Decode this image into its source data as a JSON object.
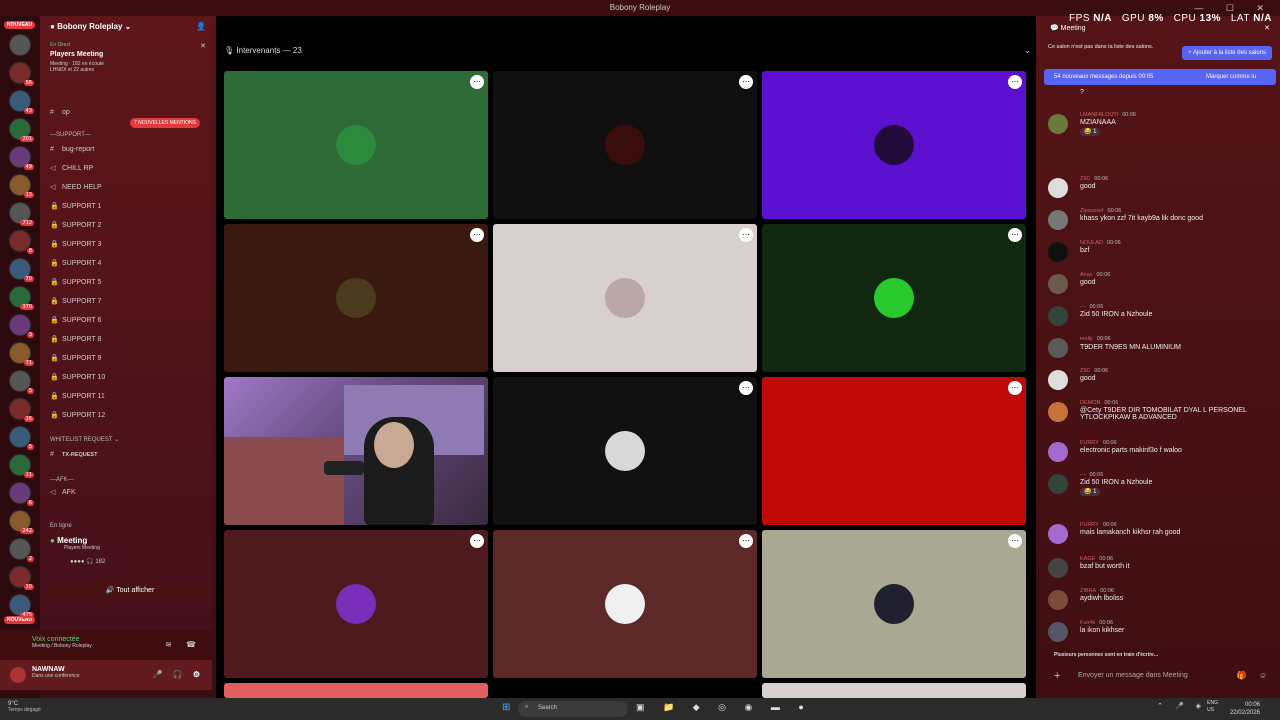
{
  "window": {
    "title": "Bobony Roleplay",
    "controls": "— ☐ ✕"
  },
  "servers": [
    {
      "badge": ""
    },
    {
      "badge": "56"
    },
    {
      "badge": "43"
    },
    {
      "badge": "201"
    },
    {
      "badge": "49"
    },
    {
      "badge": "13"
    },
    {
      "badge": "712"
    },
    {
      "badge": "8"
    },
    {
      "badge": "70"
    },
    {
      "badge": "370"
    },
    {
      "badge": "3"
    },
    {
      "badge": "71"
    },
    {
      "badge": "5"
    },
    {
      "badge": "16"
    },
    {
      "badge": "5"
    },
    {
      "badge": "11"
    },
    {
      "badge": "6"
    },
    {
      "badge": "242"
    },
    {
      "badge": "2"
    },
    {
      "badge": "10"
    },
    {
      "badge": "475"
    }
  ],
  "servers_new_label": "NOUVEAU",
  "guild": {
    "name": "Bobony Roleplay"
  },
  "event": {
    "live": "En Direct",
    "title": "Players Meeting",
    "info": "Meeting ·  182 en écoute",
    "users": "LHNIDI et 22 autres"
  },
  "mentions_pill": "7 NOUVELLES MENTIONS",
  "channel_op": "op",
  "channels": [
    {
      "icon": "#",
      "label": "bug-report"
    },
    {
      "icon": "◁",
      "label": "CHILL RP"
    },
    {
      "icon": "◁",
      "label": "NEED HELP"
    },
    {
      "icon": "🔒",
      "label": "SUPPORT 1"
    },
    {
      "icon": "🔒",
      "label": "SUPPORT 2"
    },
    {
      "icon": "🔒",
      "label": "SUPPORT 3"
    },
    {
      "icon": "🔒",
      "label": "SUPPORT 4"
    },
    {
      "icon": "🔒",
      "label": "SUPPORT 5"
    },
    {
      "icon": "🔒",
      "label": "SUPPORT 7"
    },
    {
      "icon": "🔒",
      "label": "SUPPORT 6"
    },
    {
      "icon": "🔒",
      "label": "SUPPORT 8"
    },
    {
      "icon": "🔒",
      "label": "SUPPORT 9"
    },
    {
      "icon": "🔒",
      "label": "SUPPORT 10"
    },
    {
      "icon": "🔒",
      "label": "SUPPORT 11"
    },
    {
      "icon": "🔒",
      "label": "SUPPORT 12"
    }
  ],
  "cat_support": "—SUPPORT—",
  "cat_whitelist": "WHITELIST REQUEST ⌄",
  "tx_request": "TX-REQUEST",
  "cat_afk": "—AFK—",
  "afk_channel": "AFK",
  "online_section": "En ligne",
  "meeting": {
    "name": "Meeting",
    "sub": "Players Meeting",
    "count": "182"
  },
  "show_all": "Tout afficher",
  "voice": {
    "status": "Voix connectée",
    "where": "Meeting / Bobony Roleplay"
  },
  "user": {
    "name": "NAWNAW",
    "status": "Dans une conférence"
  },
  "stage": {
    "speakers": "Intervenants — 23"
  },
  "tiles": [
    {
      "bg": "#2e6b36",
      "av": "#2c8a3c"
    },
    {
      "bg": "#0f0f0f",
      "av": "#3a0c0c"
    },
    {
      "bg": "#5b10d0",
      "av": "#220a3a"
    },
    {
      "bg": "#3a1a10",
      "av": "#4a3a1e"
    },
    {
      "bg": "#d8d0cf",
      "av": "#b9a8a7"
    },
    {
      "bg": "#102810",
      "av": "#27c92c"
    },
    {
      "bg": "webcam",
      "av": ""
    },
    {
      "bg": "#111111",
      "av": "#d8d8d8"
    },
    {
      "bg": "#c00a0a",
      "av": "#c00a0a"
    },
    {
      "bg": "#4e1a1d",
      "av": "#7a2db8"
    },
    {
      "bg": "#5c2828",
      "av": "#f0f0f0"
    },
    {
      "bg": "#a9a892",
      "av": "#202030"
    }
  ],
  "stats": {
    "fps": "FPS",
    "fps_v": "N/A",
    "gpu": "GPU",
    "gpu_v": "8%",
    "cpu": "CPU",
    "cpu_v": "13%",
    "lat": "LAT",
    "lat_v": "N/A"
  },
  "chat": {
    "title": "Meeting",
    "notice": "Ce salon n'est pas dans ta liste des salons.",
    "add_btn": "+ Ajouter à la liste des salons",
    "new_messages": "54 nouveaux messages depuis 00:05",
    "mark_read": "Marquer comme lu",
    "messages": [
      {
        "author": "",
        "time": "",
        "text": "?",
        "react": "",
        "av": "#6b2a2a"
      },
      {
        "author": "LMANFALOUTI",
        "time": "00:06",
        "text": "MZIANAAA",
        "react": "😂 1",
        "av": "#6a7a3a"
      },
      {
        "author": "Z9C",
        "time": "00:06",
        "text": "good",
        "react": "",
        "av": "#dddddd"
      },
      {
        "author": "Zlyoussef",
        "time": "00:06",
        "text": "khass ykon zzf 7it kayb9a lik donc good",
        "react": "",
        "av": "#777"
      },
      {
        "author": "NOULAD",
        "time": "00:06",
        "text": "bzf",
        "react": "",
        "av": "#111"
      },
      {
        "author": "Anas",
        "time": "00:06",
        "text": "good",
        "react": "",
        "av": "#6c5a4a"
      },
      {
        "author": "—",
        "time": "00:06",
        "text": "Zid 50 IRON a Nzhoule",
        "react": "",
        "av": "#33453a"
      },
      {
        "author": "Ⲙolly",
        "time": "00:06",
        "text": "T9DER TN9ES MN ALUMINIUM",
        "react": "",
        "av": "#5a5a5a"
      },
      {
        "author": "Z9C",
        "time": "00:06",
        "text": "good",
        "react": "",
        "av": "#dddddd"
      },
      {
        "author": "DEMON",
        "time": "00:06",
        "text": "@Cety T9DER DIR TOMOBILAT DYAL L PERSONEL YTLOCKPIKAW B ADVANCED",
        "react": "",
        "av": "#c6723a"
      },
      {
        "author": "FURRY",
        "time": "00:06",
        "text": "electronic parts makinf3o f waloo",
        "react": "",
        "av": "#a46ad0"
      },
      {
        "author": "—",
        "time": "00:06",
        "text": "Zid 50 IRON a Nzhoule",
        "react": "😂 1",
        "av": "#33453a"
      },
      {
        "author": "FURRY",
        "time": "00:06",
        "text": "mais lamakanch kikhsr rah good",
        "react": "",
        "av": "#a46ad0"
      },
      {
        "author": "KAGE",
        "time": "00:06",
        "text": "bzaf but worth it",
        "react": "",
        "av": "#444"
      },
      {
        "author": "ZIBRA",
        "time": "00:06",
        "text": "aydiwh lboliss",
        "react": "",
        "av": "#7a4a3a"
      },
      {
        "author": "Fuir4k",
        "time": "00:06",
        "text": "la ikon kikhser",
        "react": "",
        "av": "#556"
      }
    ],
    "typing": "Plusieurs personnes sont en train d'écrire...",
    "composer": "Envoyer un message dans Meeting"
  },
  "taskbar": {
    "temp": "9°C",
    "weather": "Temps dégagé",
    "search": "Search",
    "lang1": "ENG",
    "lang2": "US",
    "time": "00:06",
    "date": "22/02/2026"
  }
}
